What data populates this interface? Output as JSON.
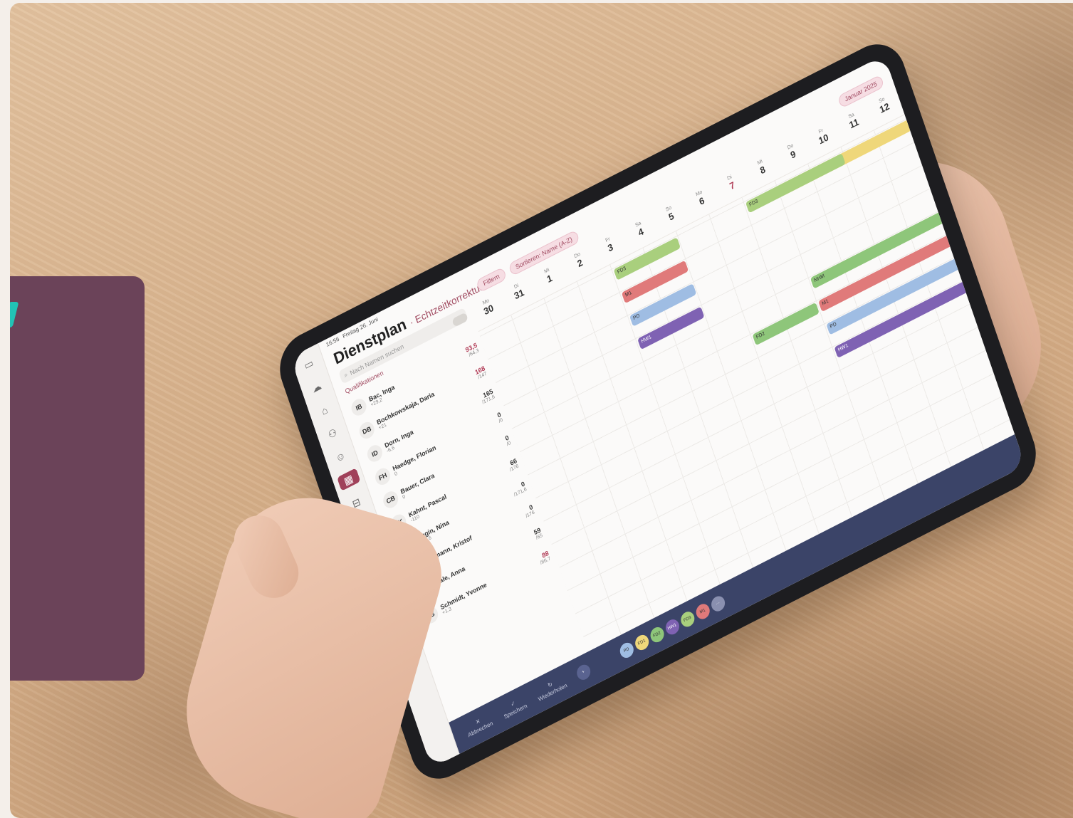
{
  "app": {
    "status_time": "16:56",
    "status_date": "Freitag 26. Juni",
    "title": "Dienstplan",
    "subtitle": "· Echtzeitkorrektur",
    "search_placeholder": "Nach Namen suchen",
    "qualifications_label": "Qualifikationen",
    "filter_label": "Filtern",
    "sort_label": "Sortieren: Name (A-Z)",
    "month_label": "Januar 2025"
  },
  "days": [
    {
      "weekday": "Mo",
      "day": "30"
    },
    {
      "weekday": "Di",
      "day": "31"
    },
    {
      "weekday": "Mi",
      "day": "1"
    },
    {
      "weekday": "Do",
      "day": "2"
    },
    {
      "weekday": "Fr",
      "day": "3"
    },
    {
      "weekday": "Sa",
      "day": "4"
    },
    {
      "weekday": "So",
      "day": "5"
    },
    {
      "weekday": "Mo",
      "day": "6"
    },
    {
      "weekday": "Di",
      "day": "7"
    },
    {
      "weekday": "Mi",
      "day": "8"
    },
    {
      "weekday": "Do",
      "day": "9"
    },
    {
      "weekday": "Fr",
      "day": "10"
    },
    {
      "weekday": "Sa",
      "day": "11"
    },
    {
      "weekday": "So",
      "day": "12"
    }
  ],
  "people": [
    {
      "initials": "IB",
      "name": "Bac, Inga",
      "delta": "+29,2",
      "hours": "93,5",
      "target": "/64,3",
      "red": true
    },
    {
      "initials": "DB",
      "name": "Bochkowskaja, Daria",
      "delta": "+21",
      "hours": "168",
      "target": "/147",
      "red": true
    },
    {
      "initials": "ID",
      "name": "Dorn, Inga",
      "delta": "-6,6",
      "hours": "165",
      "target": "/171,6",
      "red": false
    },
    {
      "initials": "FH",
      "name": "Haedge, Florian",
      "delta": "0",
      "hours": "0",
      "target": "/0",
      "red": false
    },
    {
      "initials": "CB",
      "name": "Bauer, Clara",
      "delta": "0",
      "hours": "0",
      "target": "/0",
      "red": false
    },
    {
      "initials": "PK",
      "name": "Kahnt, Pascal",
      "delta": "-110",
      "hours": "66",
      "target": "/176",
      "red": false
    },
    {
      "initials": "NM",
      "name": "Magin, Nina",
      "delta": "-171,6",
      "hours": "0",
      "target": "/171,6",
      "red": false
    },
    {
      "initials": "KP",
      "name": "Peymann, Kristof",
      "delta": "-176",
      "hours": "0",
      "target": "/176",
      "red": false
    },
    {
      "initials": "AS",
      "name": "Saale, Anna",
      "delta": "-6",
      "hours": "59",
      "target": "/65",
      "red": false
    },
    {
      "initials": "YS",
      "name": "Schmidt, Yvonne",
      "delta": "+1,3",
      "hours": "88",
      "target": "/86,7",
      "red": true
    }
  ],
  "shifts": [
    {
      "label": "FD3",
      "color": "#a9cf7d"
    },
    {
      "label": "M1",
      "color": "#e07a7a"
    },
    {
      "label": "PD",
      "color": "#9fbde3"
    },
    {
      "label": "HW1",
      "color": "#7f62b3"
    },
    {
      "label": "FD1",
      "color": "#efd77a"
    },
    {
      "label": "NHM",
      "color": "#8ec67a"
    },
    {
      "label": "FD2",
      "color": "#8ec67a"
    }
  ],
  "bottom_bar": {
    "cancel": "Abbrechen",
    "save": "Speichern",
    "restore": "Wiederholen",
    "pills": [
      "PD",
      "FD1",
      "FD2",
      "HW1",
      "FD3",
      "M1",
      "···"
    ]
  },
  "colors": {
    "brand": "#a24d63",
    "bar": "#3b4468",
    "card": "#6b4359",
    "teal": "#22c3b5"
  }
}
